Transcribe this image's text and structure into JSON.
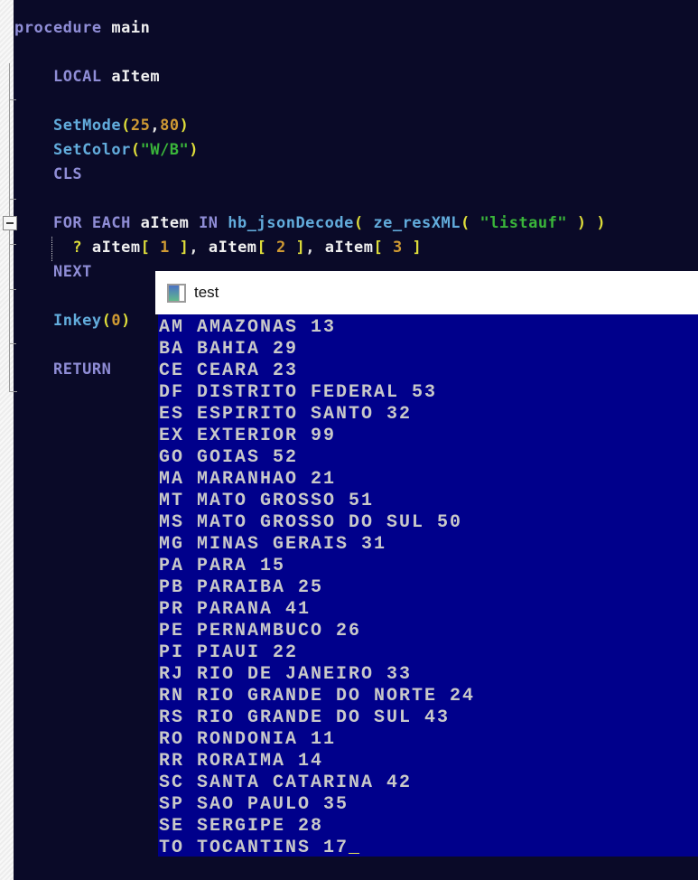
{
  "window": {
    "title": "test",
    "icon": "console-window-icon"
  },
  "editor": {
    "lines": [
      {
        "indent": 0,
        "tokens": [
          [
            "kw",
            "procedure"
          ],
          [
            "pl",
            " "
          ],
          [
            "id",
            "main"
          ]
        ]
      },
      {
        "indent": 0,
        "tokens": []
      },
      {
        "indent": 4,
        "tokens": [
          [
            "kw",
            "LOCAL"
          ],
          [
            "pl",
            " "
          ],
          [
            "id",
            "aItem"
          ]
        ]
      },
      {
        "indent": 0,
        "tokens": []
      },
      {
        "indent": 4,
        "tokens": [
          [
            "fn",
            "SetMode"
          ],
          [
            "par",
            "("
          ],
          [
            "num",
            "25"
          ],
          [
            "pl",
            ","
          ],
          [
            "num",
            "80"
          ],
          [
            "par",
            ")"
          ]
        ]
      },
      {
        "indent": 4,
        "tokens": [
          [
            "fn",
            "SetColor"
          ],
          [
            "par",
            "("
          ],
          [
            "str",
            "\"W/B\""
          ],
          [
            "par",
            ")"
          ]
        ]
      },
      {
        "indent": 4,
        "tokens": [
          [
            "kw",
            "CLS"
          ]
        ]
      },
      {
        "indent": 0,
        "tokens": []
      },
      {
        "indent": 4,
        "tokens": [
          [
            "kw",
            "FOR"
          ],
          [
            "pl",
            " "
          ],
          [
            "kw",
            "EACH"
          ],
          [
            "pl",
            " "
          ],
          [
            "id",
            "aItem"
          ],
          [
            "pl",
            " "
          ],
          [
            "kw",
            "IN"
          ],
          [
            "pl",
            " "
          ],
          [
            "fn",
            "hb_jsonDecode"
          ],
          [
            "par",
            "("
          ],
          [
            "pl",
            " "
          ],
          [
            "fn",
            "ze_resXML"
          ],
          [
            "par",
            "("
          ],
          [
            "pl",
            " "
          ],
          [
            "str",
            "\"listauf\""
          ],
          [
            "pl",
            " "
          ],
          [
            "par",
            ")"
          ],
          [
            "pl",
            " "
          ],
          [
            "par",
            ")"
          ]
        ]
      },
      {
        "indent": 6,
        "tokens": [
          [
            "par",
            "?"
          ],
          [
            "pl",
            " "
          ],
          [
            "id",
            "aItem"
          ],
          [
            "par",
            "["
          ],
          [
            "pl",
            " "
          ],
          [
            "num",
            "1"
          ],
          [
            "pl",
            " "
          ],
          [
            "par",
            "]"
          ],
          [
            "pl",
            ","
          ],
          [
            "pl",
            " "
          ],
          [
            "id",
            "aItem"
          ],
          [
            "par",
            "["
          ],
          [
            "pl",
            " "
          ],
          [
            "num",
            "2"
          ],
          [
            "pl",
            " "
          ],
          [
            "par",
            "]"
          ],
          [
            "pl",
            ","
          ],
          [
            "pl",
            " "
          ],
          [
            "id",
            "aItem"
          ],
          [
            "par",
            "["
          ],
          [
            "pl",
            " "
          ],
          [
            "num",
            "3"
          ],
          [
            "pl",
            " "
          ],
          [
            "par",
            "]"
          ]
        ]
      },
      {
        "indent": 4,
        "tokens": [
          [
            "kw",
            "NEXT"
          ]
        ]
      },
      {
        "indent": 0,
        "tokens": []
      },
      {
        "indent": 4,
        "tokens": [
          [
            "fn",
            "Inkey"
          ],
          [
            "par",
            "("
          ],
          [
            "num",
            "0"
          ],
          [
            "par",
            ")"
          ]
        ]
      },
      {
        "indent": 0,
        "tokens": []
      },
      {
        "indent": 4,
        "tokens": [
          [
            "kw",
            "RETURN"
          ]
        ]
      }
    ]
  },
  "console": {
    "rows": [
      "AM AMAZONAS 13",
      "BA BAHIA 29",
      "CE CEARA 23",
      "DF DISTRITO FEDERAL 53",
      "ES ESPIRITO SANTO 32",
      "EX EXTERIOR 99",
      "GO GOIAS 52",
      "MA MARANHAO 21",
      "MT MATO GROSSO 51",
      "MS MATO GROSSO DO SUL 50",
      "MG MINAS GERAIS 31",
      "PA PARA 15",
      "PB PARAIBA 25",
      "PR PARANA 41",
      "PE PERNAMBUCO 26",
      "PI PIAUI 22",
      "RJ RIO DE JANEIRO 33",
      "RN RIO GRANDE DO NORTE 24",
      "RS RIO GRANDE DO SUL 43",
      "RO RONDONIA 11",
      "RR RORAIMA 14",
      "SC SANTA CATARINA 42",
      "SP SAO PAULO 35",
      "SE SERGIPE 28",
      "TO TOCANTINS 17"
    ],
    "cursor": "_"
  },
  "colors": {
    "kw": "#8f8dd6",
    "fn": "#62acdc",
    "par": "#dedd3a",
    "num": "#cf9a33",
    "str": "#3ab53a",
    "id": "#f0f0f0",
    "pl": "#e6e6e6",
    "editor_bg": "#0a0a28",
    "console_bg": "#00008b",
    "console_text": "#c9c9c9",
    "cursor": "#f2ef55",
    "titlebar_bg": "#ffffff",
    "title_text": "#111111"
  }
}
